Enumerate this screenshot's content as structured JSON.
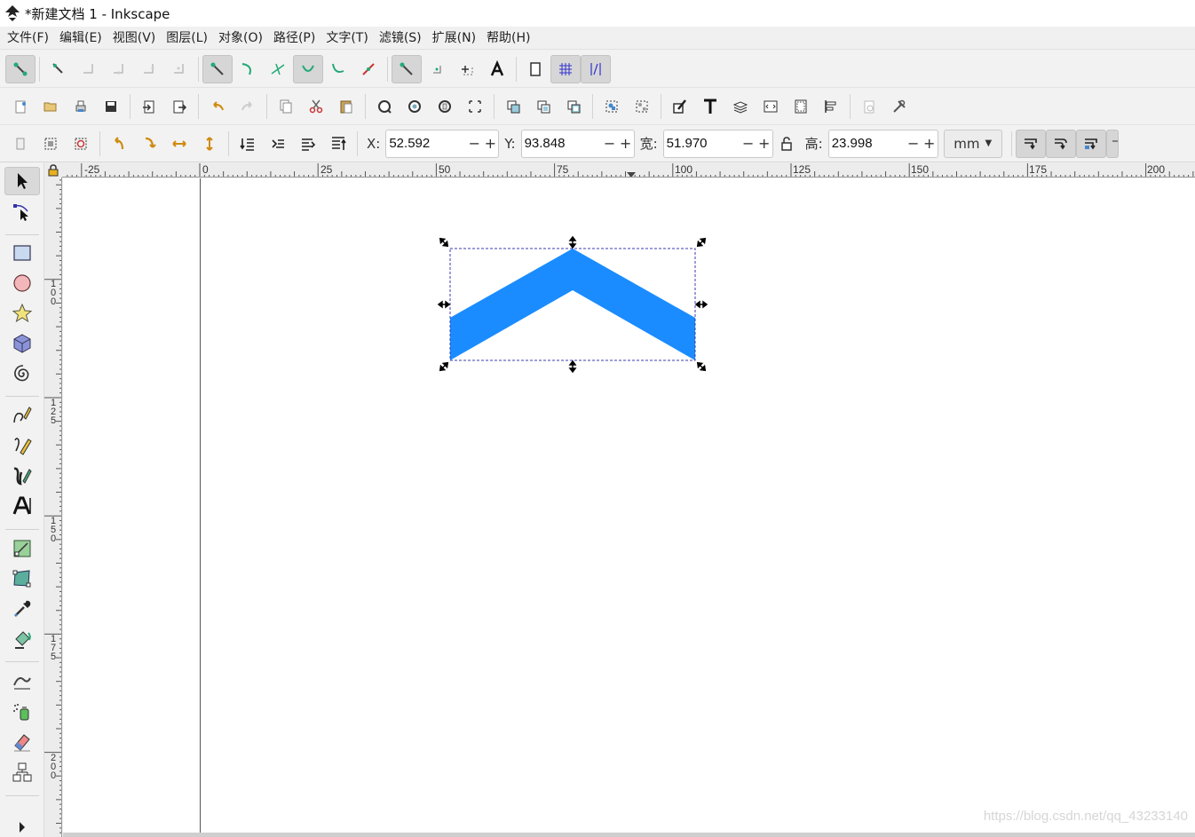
{
  "window": {
    "title": "*新建文档 1 - Inkscape"
  },
  "menu": [
    "文件(F)",
    "编辑(E)",
    "视图(V)",
    "图层(L)",
    "对象(O)",
    "路径(P)",
    "文字(T)",
    "滤镜(S)",
    "扩展(N)",
    "帮助(H)"
  ],
  "controls": {
    "x_label": "X:",
    "x_value": "52.592",
    "y_label": "Y:",
    "y_value": "93.848",
    "w_label": "宽:",
    "w_value": "51.970",
    "h_label": "高:",
    "h_value": "23.998",
    "unit": "mm",
    "minus": "−",
    "plus": "+"
  },
  "ruler": {
    "h_labels": [
      "-25",
      "0",
      "25",
      "50",
      "75",
      "100",
      "125",
      "150",
      "175",
      "200"
    ],
    "v_labels": [
      [
        "1",
        "0",
        "0"
      ],
      [
        "1",
        "2",
        "5"
      ],
      [
        "1",
        "5",
        "0"
      ],
      [
        "1",
        "7",
        "5"
      ],
      [
        "2",
        "0",
        "0"
      ]
    ]
  },
  "canvas": {
    "shape_color": "#1a8cff",
    "watermark": "https://blog.csdn.net/qq_43233140"
  }
}
